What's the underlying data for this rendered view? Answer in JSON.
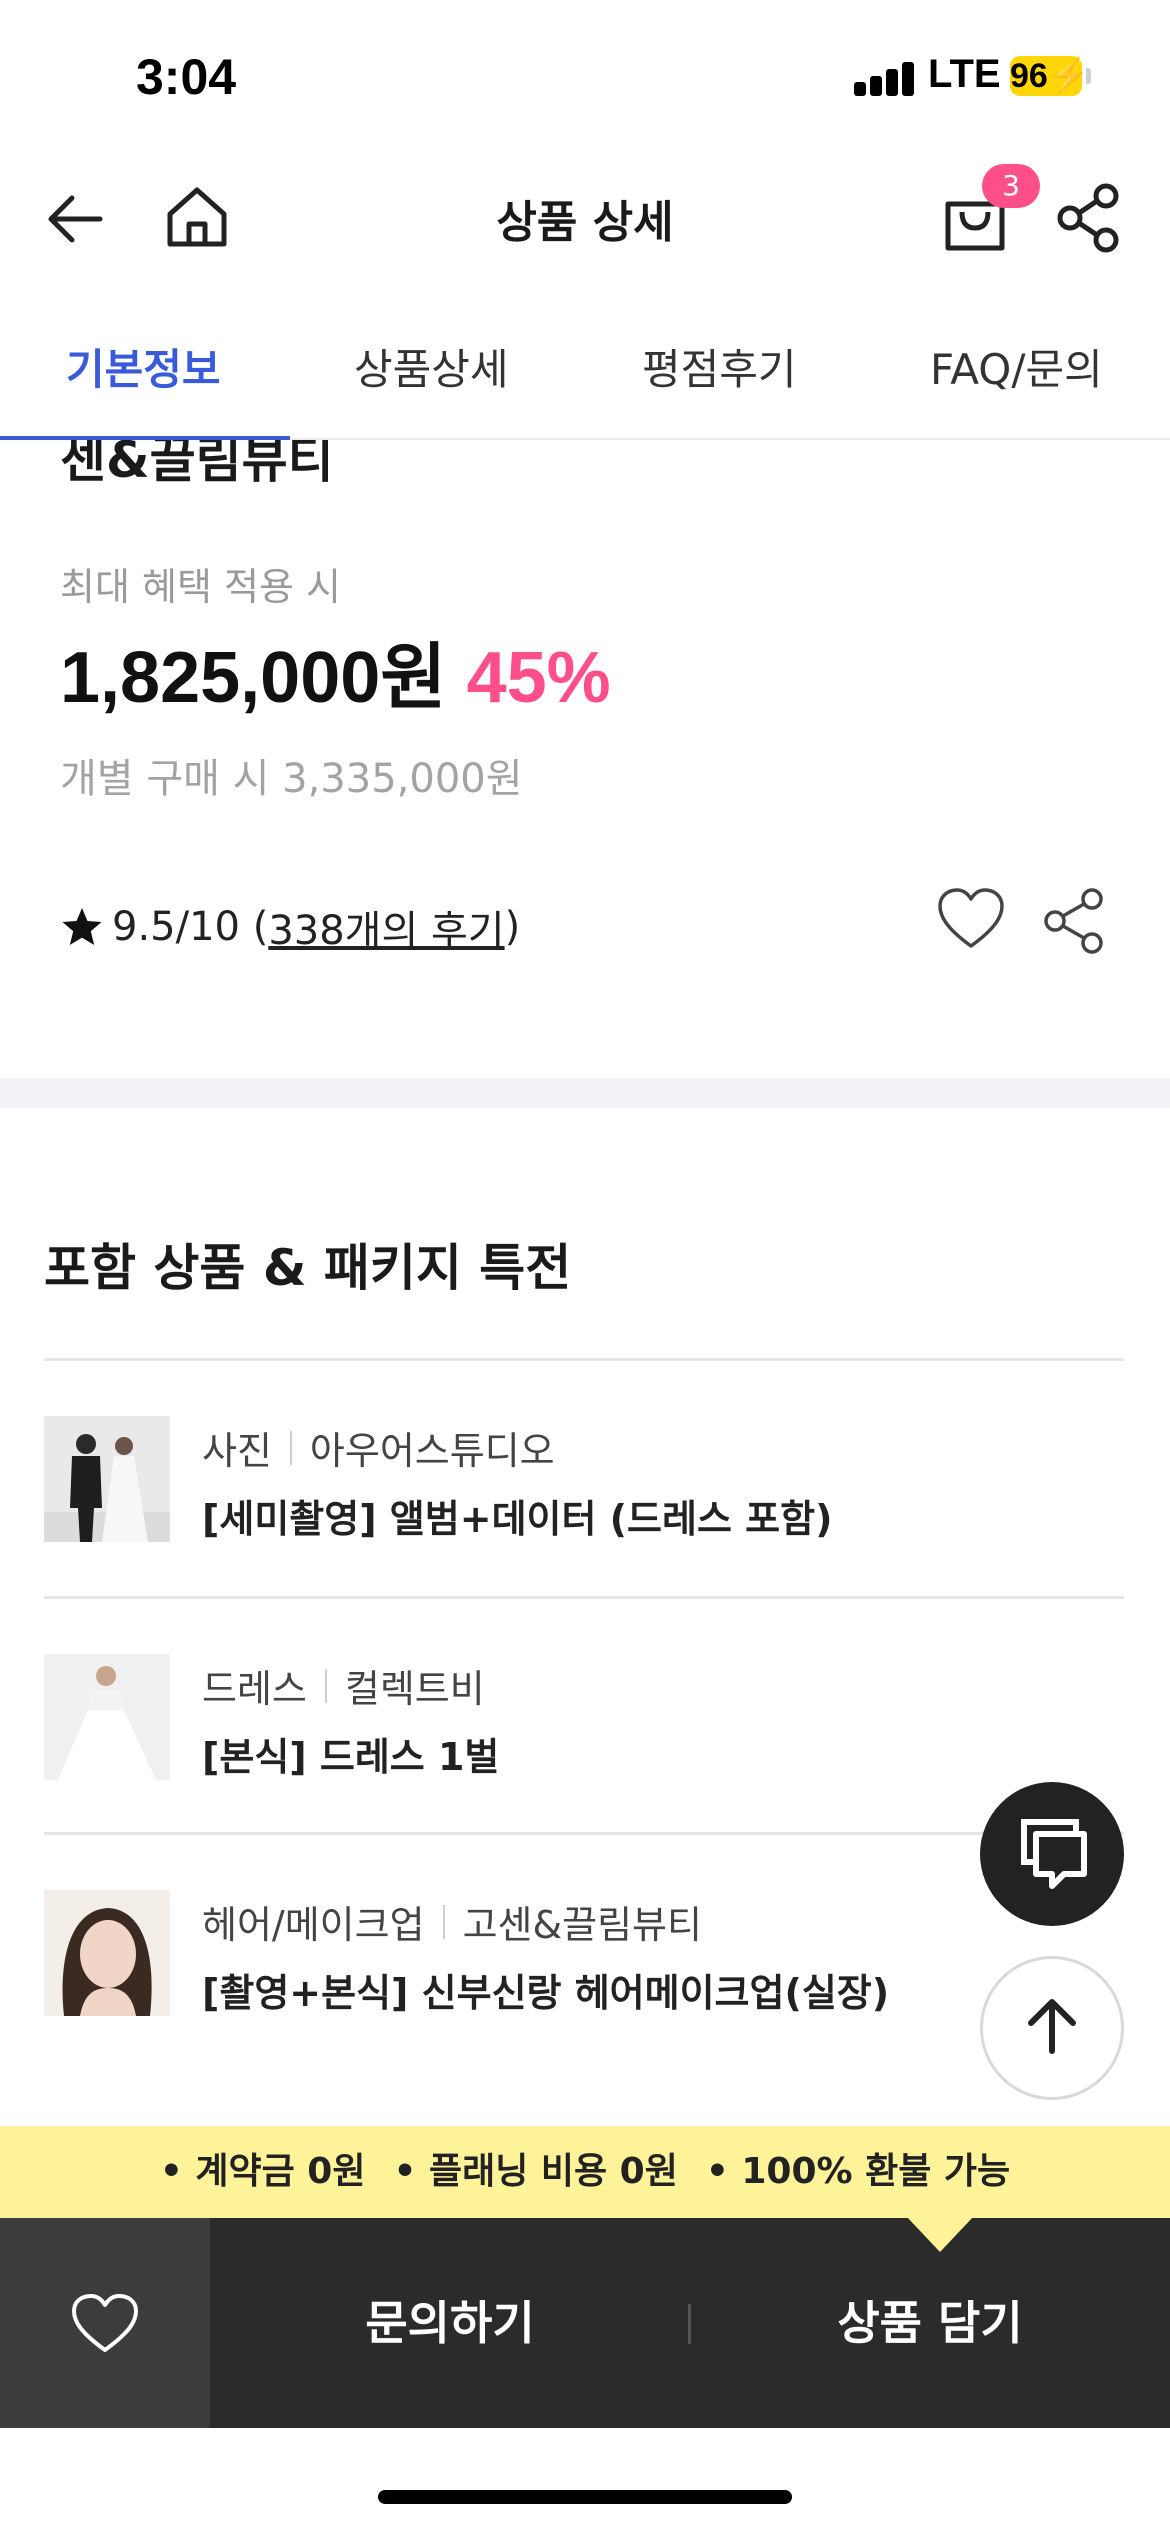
{
  "status_bar": {
    "time": "3:04",
    "network": "LTE",
    "battery": "96"
  },
  "header": {
    "title": "상품 상세",
    "cart_count": "3"
  },
  "tabs": [
    {
      "label": "기본정보",
      "active": true
    },
    {
      "label": "상품상세",
      "active": false
    },
    {
      "label": "평점후기",
      "active": false
    },
    {
      "label": "FAQ/문의",
      "active": false
    }
  ],
  "product": {
    "vendor_partial": "센&끌림뷰티",
    "benefit_label": "최대 혜택 적용 시",
    "price": "1,825,000원",
    "discount": "45%",
    "individual_price": "개별 구매 시 3,335,000원",
    "rating_text": "9.5/10 (",
    "review_link": "338개의 후기",
    "rating_close": ")"
  },
  "packages": {
    "title": "포함 상품 & 패키지 특전",
    "items": [
      {
        "category": "사진",
        "vendor": "아우어스튜디오",
        "name": "[세미촬영] 앨범+데이터 (드레스 포함)"
      },
      {
        "category": "드레스",
        "vendor": "컬렉트비",
        "name": "[본식] 드레스 1벌"
      },
      {
        "category": "헤어/메이크업",
        "vendor": "고센&끌림뷰티",
        "name": "[촬영+본식] 신부신랑 헤어메이크업(실장)"
      }
    ]
  },
  "promo": {
    "items": [
      "• 계약금 0원",
      "• 플래닝 비용 0원",
      "• 100% 환불 가능"
    ]
  },
  "bottom_bar": {
    "inquiry_label": "문의하기",
    "cart_label": "상품 담기"
  },
  "colors": {
    "accent_blue": "#3a5bd9",
    "discount_pink": "#ff4f8b",
    "promo_yellow": "#fff39a",
    "bottom_dark": "#2b2b2b"
  }
}
